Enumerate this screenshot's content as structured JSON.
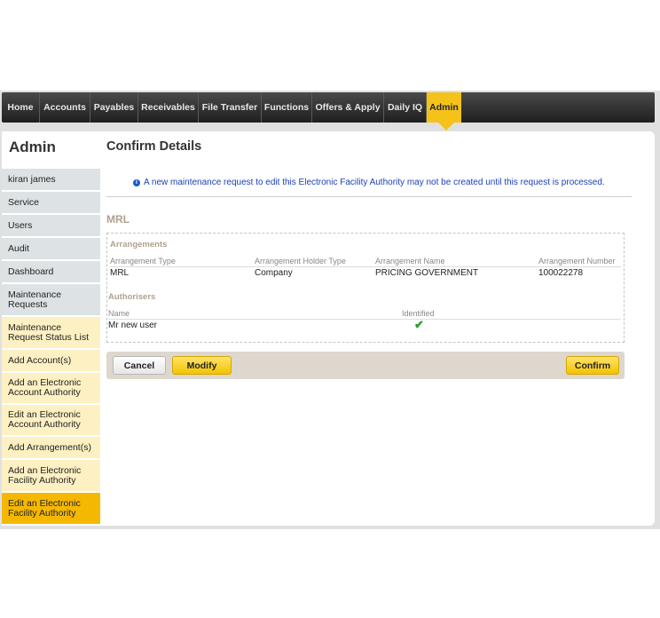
{
  "nav": {
    "items": [
      "Home",
      "Accounts",
      "Payables",
      "Receivables",
      "File Transfer",
      "Functions",
      "Offers & Apply",
      "Daily IQ",
      "Admin"
    ],
    "active_index": 8
  },
  "sidebar": {
    "title": "Admin",
    "items": [
      {
        "label": "kiran james",
        "style": "grey"
      },
      {
        "label": "Service",
        "style": "grey"
      },
      {
        "label": "Users",
        "style": "grey"
      },
      {
        "label": "Audit",
        "style": "grey"
      },
      {
        "label": "Dashboard",
        "style": "grey"
      },
      {
        "label": "Maintenance Requests",
        "style": "grey"
      },
      {
        "label": "Maintenance Request Status List",
        "style": "cream"
      },
      {
        "label": "Add Account(s)",
        "style": "cream"
      },
      {
        "label": "Add an Electronic Account Authority",
        "style": "cream"
      },
      {
        "label": "Edit an Electronic Account Authority",
        "style": "cream"
      },
      {
        "label": "Add Arrangement(s)",
        "style": "cream"
      },
      {
        "label": "Add an Electronic Facility Authority",
        "style": "cream"
      },
      {
        "label": "Edit an Electronic Facility Authority",
        "style": "active"
      }
    ]
  },
  "main": {
    "title": "Confirm Details",
    "info_message": "A new maintenance request to edit this Electronic Facility Authority may not be created until this request is processed.",
    "info_icon": "info-icon",
    "section_title": "MRL",
    "arrangements": {
      "heading": "Arrangements",
      "columns": [
        "Arrangement Type",
        "Arrangement Holder Type",
        "Arrangement Name",
        "Arrangement Number"
      ],
      "row": [
        "MRL",
        "Company",
        "PRICING GOVERNMENT",
        "100022278"
      ]
    },
    "authorisers": {
      "heading": "Authorisers",
      "columns": [
        "Name",
        "Identified"
      ],
      "row": {
        "name": "Mr new user",
        "identified_icon": "checkmark-icon",
        "identified_glyph": "✔"
      }
    },
    "buttons": {
      "cancel": "Cancel",
      "modify": "Modify",
      "confirm": "Confirm"
    }
  },
  "colors": {
    "accent": "#f5c21a",
    "nav_bg": "#2b2b2b",
    "info_text": "#1a3fb8",
    "section_heading": "#b0a090"
  }
}
